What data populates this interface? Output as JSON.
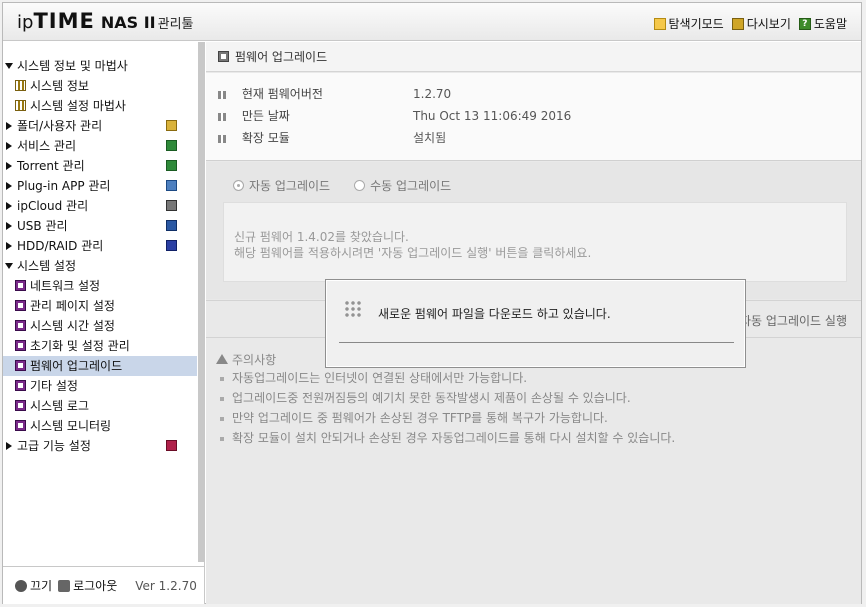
{
  "header": {
    "logo_ip": "ip",
    "logo_time": "TIME",
    "logo_nas": "NAS II",
    "logo_admin": "관리툴",
    "links": {
      "explorer": "탐색기모드",
      "refresh": "다시보기",
      "help": "도움말"
    }
  },
  "sidebar": {
    "items": [
      {
        "label": "시스템 정보 및 마법사",
        "type": "group",
        "expanded": true
      },
      {
        "label": "시스템 정보",
        "type": "sub"
      },
      {
        "label": "시스템 설정 마법사",
        "type": "sub"
      },
      {
        "label": "폴더/사용자 관리",
        "type": "group",
        "icon": "folder-user-icon"
      },
      {
        "label": "서비스 관리",
        "type": "group",
        "icon": "service-icon"
      },
      {
        "label": "Torrent 관리",
        "type": "group",
        "icon": "torrent-icon"
      },
      {
        "label": "Plug-in APP 관리",
        "type": "group",
        "icon": "plugin-icon"
      },
      {
        "label": "ipCloud 관리",
        "type": "group",
        "icon": "cloud-icon"
      },
      {
        "label": "USB 관리",
        "type": "group",
        "icon": "usb-icon"
      },
      {
        "label": "HDD/RAID 관리",
        "type": "group",
        "icon": "hdd-icon"
      },
      {
        "label": "시스템 설정",
        "type": "group",
        "expanded": true
      },
      {
        "label": "네트워크 설정",
        "type": "sub"
      },
      {
        "label": "관리 페이지 설정",
        "type": "sub"
      },
      {
        "label": "시스템 시간 설정",
        "type": "sub"
      },
      {
        "label": "초기화 및 설정 관리",
        "type": "sub"
      },
      {
        "label": "펌웨어 업그레이드",
        "type": "sub",
        "active": true
      },
      {
        "label": "기타 설정",
        "type": "sub"
      },
      {
        "label": "시스템 로그",
        "type": "sub"
      },
      {
        "label": "시스템 모니터링",
        "type": "sub"
      },
      {
        "label": "고급 기능 설정",
        "type": "group",
        "icon": "advanced-icon"
      }
    ],
    "footer": {
      "power": "끄기",
      "logout": "로그아웃",
      "version": "Ver 1.2.70"
    }
  },
  "main": {
    "title": "펌웨어 업그레이드",
    "info": [
      {
        "label": "현재 펌웨어버전",
        "value": "1.2.70"
      },
      {
        "label": "만든 날짜",
        "value": "Thu Oct 13 11:06:49 2016"
      },
      {
        "label": "확장 모듈",
        "value": "설치됨"
      }
    ],
    "radios": {
      "auto": "자동 업그레이드",
      "manual": "수동 업그레이드",
      "selected": "auto"
    },
    "message": {
      "line1": "신규 펌웨어 1.4.02를 찾았습니다.",
      "line2": "해당 펌웨어를 적용하시려면 '자동 업그레이드 실행' 버튼을 클릭하세요."
    },
    "run_label": "자동 업그레이드 실행",
    "notes": {
      "title": "주의사항",
      "items": [
        "자동업그레이드는 인터넷이 연결된 상태에서만 가능합니다.",
        "업그레이드중 전원꺼짐등의 예기치 못한 동작발생시 제품이 손상될 수 있습니다.",
        "만약 업그레이드 중 펌웨어가 손상된 경우 TFTP를 통해 복구가 가능합니다.",
        "확장 모듈이 설치 안되거나 손상된 경우 자동업그레이드를 통해 다시 설치할 수 있습니다."
      ]
    }
  },
  "dialog": {
    "message": "새로운 펌웨어 파일을 다운로드 하고 있습니다."
  }
}
